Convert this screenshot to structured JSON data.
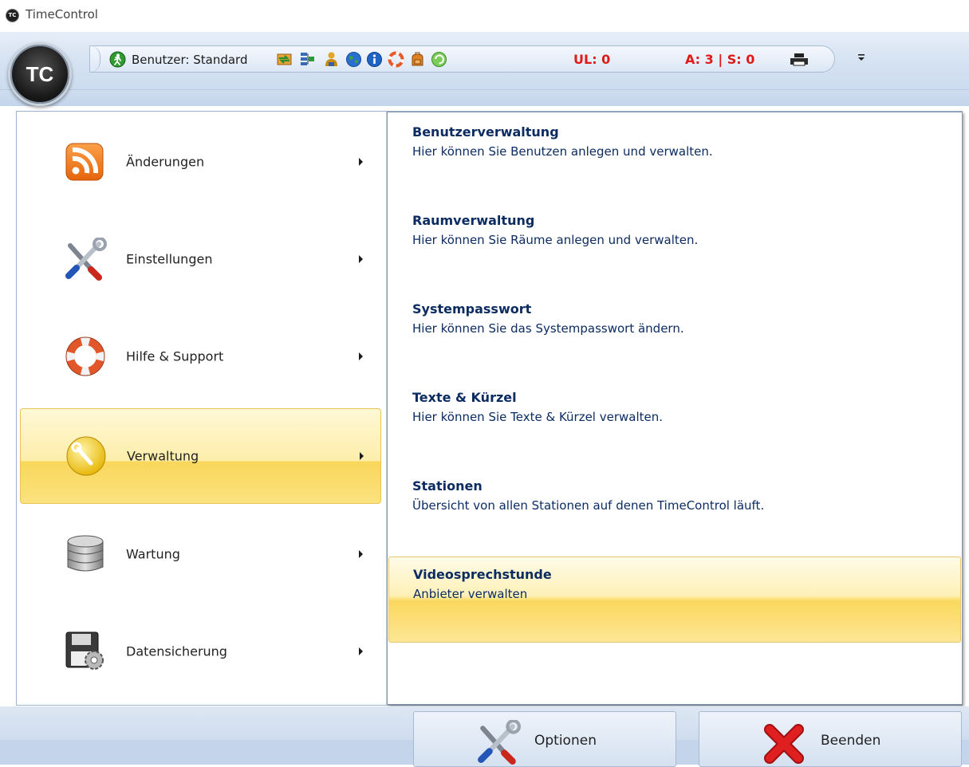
{
  "window": {
    "title": "TimeControl",
    "logo_text": "TC"
  },
  "app_orb": {
    "text": "TC"
  },
  "quick_access": {
    "user_label": "Benutzer: Standard",
    "ul_label": "UL: 0",
    "as_label": "A: 3 | S: 0",
    "icons": [
      "user-status-icon",
      "sync-icon",
      "network-icon",
      "user-icon",
      "globe-icon",
      "info-icon",
      "lifebuoy-icon",
      "backpack-icon",
      "refresh-globe-icon",
      "printer-icon",
      "customize-dropdown-icon"
    ]
  },
  "menu": {
    "items": [
      {
        "label": "Änderungen",
        "icon": "rss-icon",
        "active": false
      },
      {
        "label": "Einstellungen",
        "icon": "tools-icon",
        "active": false
      },
      {
        "label": "Hilfe & Support",
        "icon": "lifebuoy-icon",
        "active": false
      },
      {
        "label": "Verwaltung",
        "icon": "wrench-icon",
        "active": true
      },
      {
        "label": "Wartung",
        "icon": "database-icon",
        "active": false
      },
      {
        "label": "Datensicherung",
        "icon": "floppy-gear-icon",
        "active": false
      }
    ]
  },
  "submenu": {
    "items": [
      {
        "title": "Benutzerverwaltung",
        "desc": "Hier können Sie Benutzen anlegen und verwalten.",
        "active": false
      },
      {
        "title": "Raumverwaltung",
        "desc": "Hier können Sie Räume anlegen und verwalten.",
        "active": false
      },
      {
        "title": "Systempasswort",
        "desc": "Hier können Sie das Systempasswort ändern.",
        "active": false
      },
      {
        "title": "Texte & Kürzel",
        "desc": "Hier können Sie Texte & Kürzel verwalten.",
        "active": false
      },
      {
        "title": "Stationen",
        "desc": "Übersicht von allen Stationen auf denen TimeControl läuft.",
        "active": false
      },
      {
        "title": "Videosprechstunde",
        "desc": "Anbieter verwalten",
        "active": true
      }
    ]
  },
  "footer": {
    "options_label": "Optionen",
    "exit_label": "Beenden"
  },
  "colors": {
    "alert_red": "#e01919",
    "title_navy": "#0c2c61",
    "highlight_gold": "#f9d75b"
  }
}
